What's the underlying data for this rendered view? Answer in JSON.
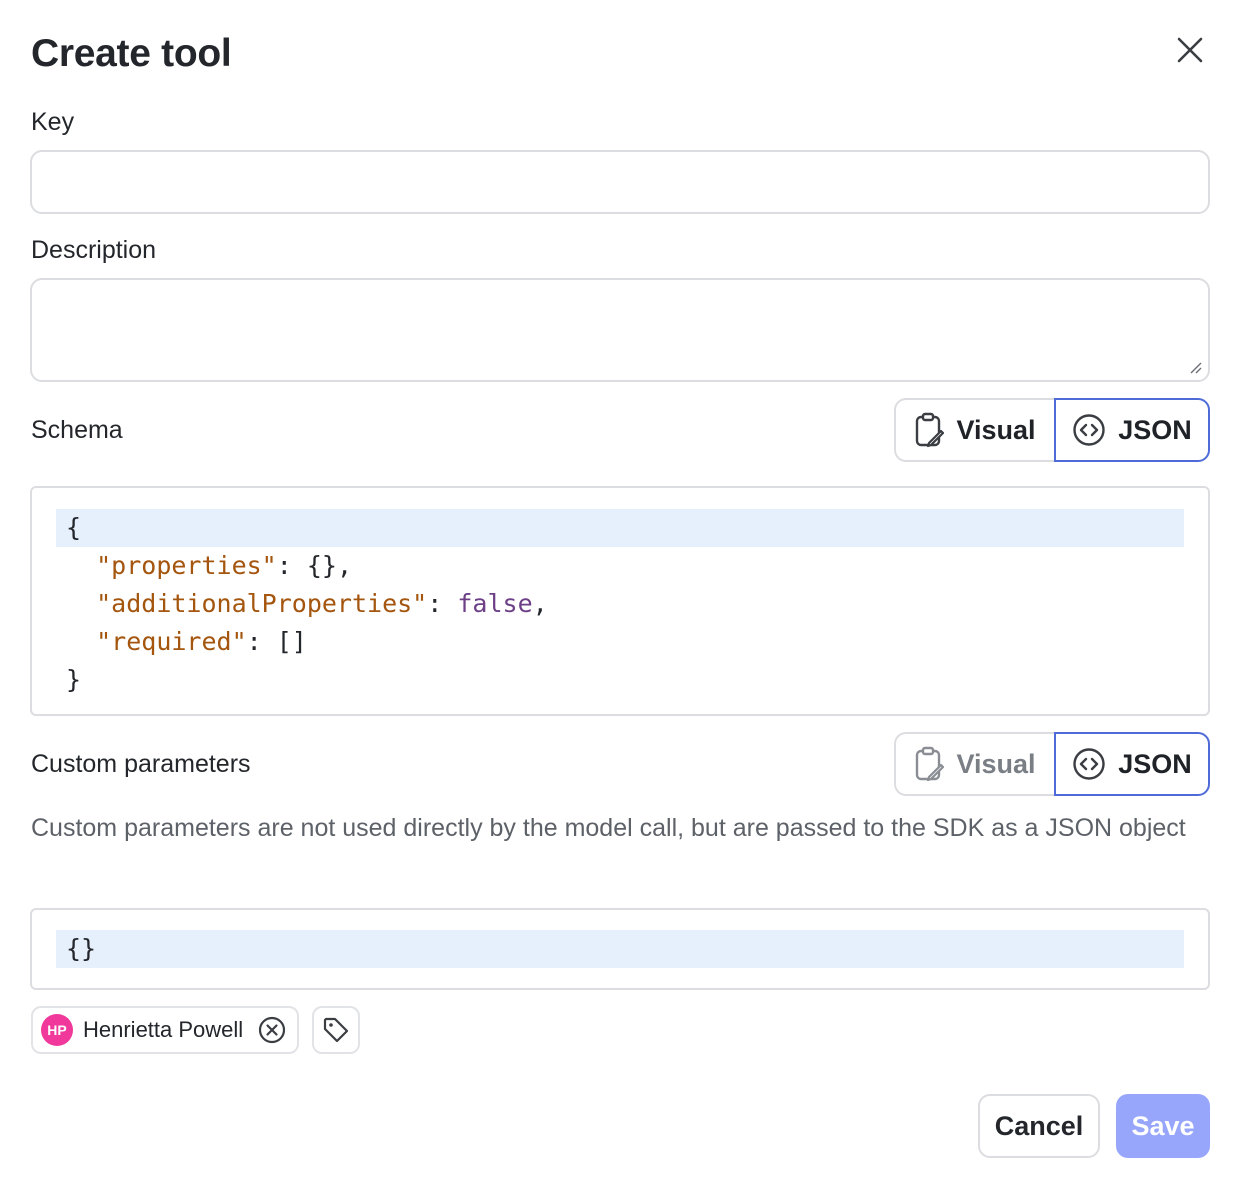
{
  "dialog": {
    "title": "Create tool",
    "close_icon": "close-icon"
  },
  "form": {
    "key_label": "Key",
    "key_value": "",
    "description_label": "Description",
    "description_value": "",
    "schema_label": "Schema",
    "schema_toggle": {
      "visual": "Visual",
      "json": "JSON",
      "selected": "JSON"
    },
    "schema_code": {
      "l1": "{",
      "l2_key": "\"properties\"",
      "l2_rest": ": {},",
      "l3_key": "\"additionalProperties\"",
      "l3_sep": ": ",
      "l3_val": "false",
      "l3_end": ",",
      "l4_key": "\"required\"",
      "l4_rest": ": []",
      "l5": "}"
    },
    "custom_label": "Custom parameters",
    "custom_toggle": {
      "visual": "Visual",
      "json": "JSON",
      "selected": "JSON"
    },
    "custom_help": "Custom parameters are not used directly by the model call, but are passed to the SDK as a JSON object",
    "custom_code": "{}"
  },
  "owner_chip": {
    "initials": "HP",
    "name": "Henrietta Powell",
    "avatar_color": "#f0399a"
  },
  "actions": {
    "cancel": "Cancel",
    "save": "Save",
    "save_color": "#97a6fb"
  }
}
